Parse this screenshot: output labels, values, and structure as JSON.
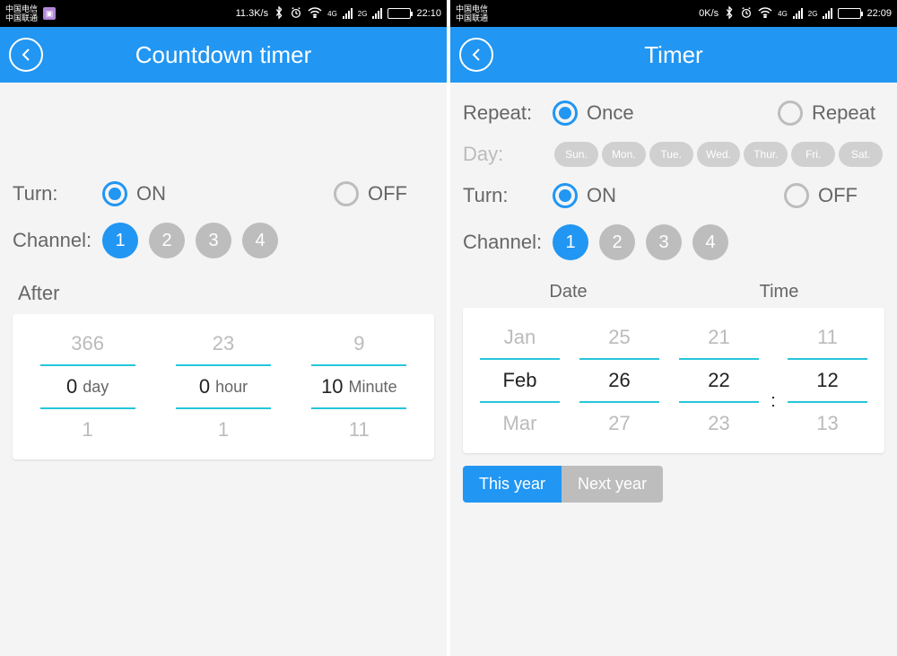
{
  "left": {
    "status": {
      "carrier1": "中国电信",
      "carrier2": "中国联通",
      "speed": "11.3K/s",
      "net4g": "4G",
      "net2g": "2G",
      "time": "22:10"
    },
    "header": {
      "title": "Countdown timer"
    },
    "turn": {
      "label": "Turn:",
      "on": "ON",
      "off": "OFF"
    },
    "channel": {
      "label": "Channel:",
      "c1": "1",
      "c2": "2",
      "c3": "3",
      "c4": "4"
    },
    "after": "After",
    "picker": {
      "day_prev": "366",
      "day_cur": "0",
      "day_next": "1",
      "day_unit": "day",
      "hour_prev": "23",
      "hour_cur": "0",
      "hour_next": "1",
      "hour_unit": "hour",
      "min_prev": "9",
      "min_cur": "10",
      "min_next": "11",
      "min_unit": "Minute"
    }
  },
  "right": {
    "status": {
      "carrier1": "中国电信",
      "carrier2": "中国联通",
      "speed": "0K/s",
      "net4g": "4G",
      "net2g": "2G",
      "time": "22:09"
    },
    "header": {
      "title": "Timer"
    },
    "repeat": {
      "label": "Repeat:",
      "once": "Once",
      "rep": "Repeat"
    },
    "day": {
      "label": "Day:",
      "sun": "Sun.",
      "mon": "Mon.",
      "tue": "Tue.",
      "wed": "Wed.",
      "thu": "Thur.",
      "fri": "Fri.",
      "sat": "Sat."
    },
    "turn": {
      "label": "Turn:",
      "on": "ON",
      "off": "OFF"
    },
    "channel": {
      "label": "Channel:",
      "c1": "1",
      "c2": "2",
      "c3": "3",
      "c4": "4"
    },
    "dt": {
      "date": "Date",
      "time": "Time",
      "m_prev": "Jan",
      "m_cur": "Feb",
      "m_next": "Mar",
      "d_prev": "25",
      "d_cur": "26",
      "d_next": "27",
      "h_prev": "21",
      "h_cur": "22",
      "h_next": "23",
      "mi_prev": "11",
      "mi_cur": "12",
      "mi_next": "13",
      "colon": ":"
    },
    "year": {
      "this": "This year",
      "next": "Next year"
    }
  }
}
